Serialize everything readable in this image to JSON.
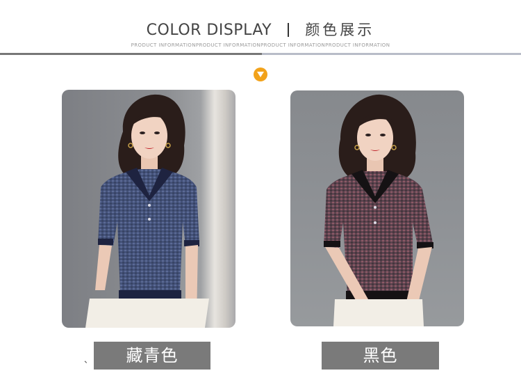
{
  "header": {
    "title_en": "COLOR DISPLAY",
    "title_cn": "颜色展示",
    "subtitle": "PRODUCT INFORMATIONPRODUCT INFORMATIONPRODUCT INFORMATIONPRODUCT INFORMATION"
  },
  "colors": [
    {
      "label": "藏青色",
      "swatch": "#3d4b73"
    },
    {
      "label": "黑色",
      "swatch": "#6b4a56"
    }
  ],
  "marks": {
    "stray_mark": "、"
  },
  "theme": {
    "accent": "#f2a21a",
    "label_bg": "#7a7a7a"
  }
}
